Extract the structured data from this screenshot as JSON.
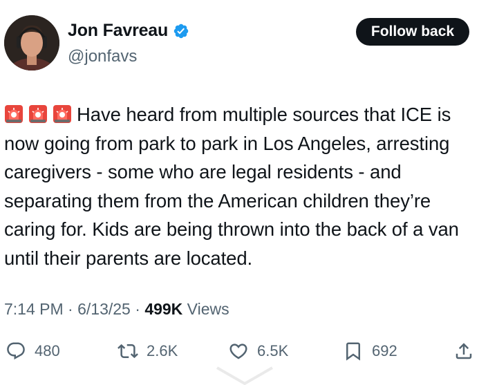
{
  "author": {
    "display_name": "Jon Favreau",
    "handle": "@jonfavs",
    "verified": true
  },
  "follow_button": {
    "label": "Follow back"
  },
  "tweet": {
    "emoji": [
      "police-car-light",
      "police-car-light",
      "police-car-light"
    ],
    "text": "Have heard from multiple sources that ICE is now going from park to park in Los Angeles, arresting caregivers - some who are legal residents - and separating them from the American children they’re caring for. Kids are being thrown into the back of a van until their parents are located."
  },
  "meta": {
    "time": "7:14 PM",
    "separator": " · ",
    "date": "6/13/25",
    "views_count": "499K",
    "views_label": " Views"
  },
  "actions": {
    "replies": "480",
    "reposts": "2.6K",
    "likes": "6.5K",
    "bookmarks": "692"
  },
  "colors": {
    "text": "#0f1419",
    "secondary": "#536471",
    "verified": "#1d9bf0",
    "button_bg": "#0f1419"
  }
}
